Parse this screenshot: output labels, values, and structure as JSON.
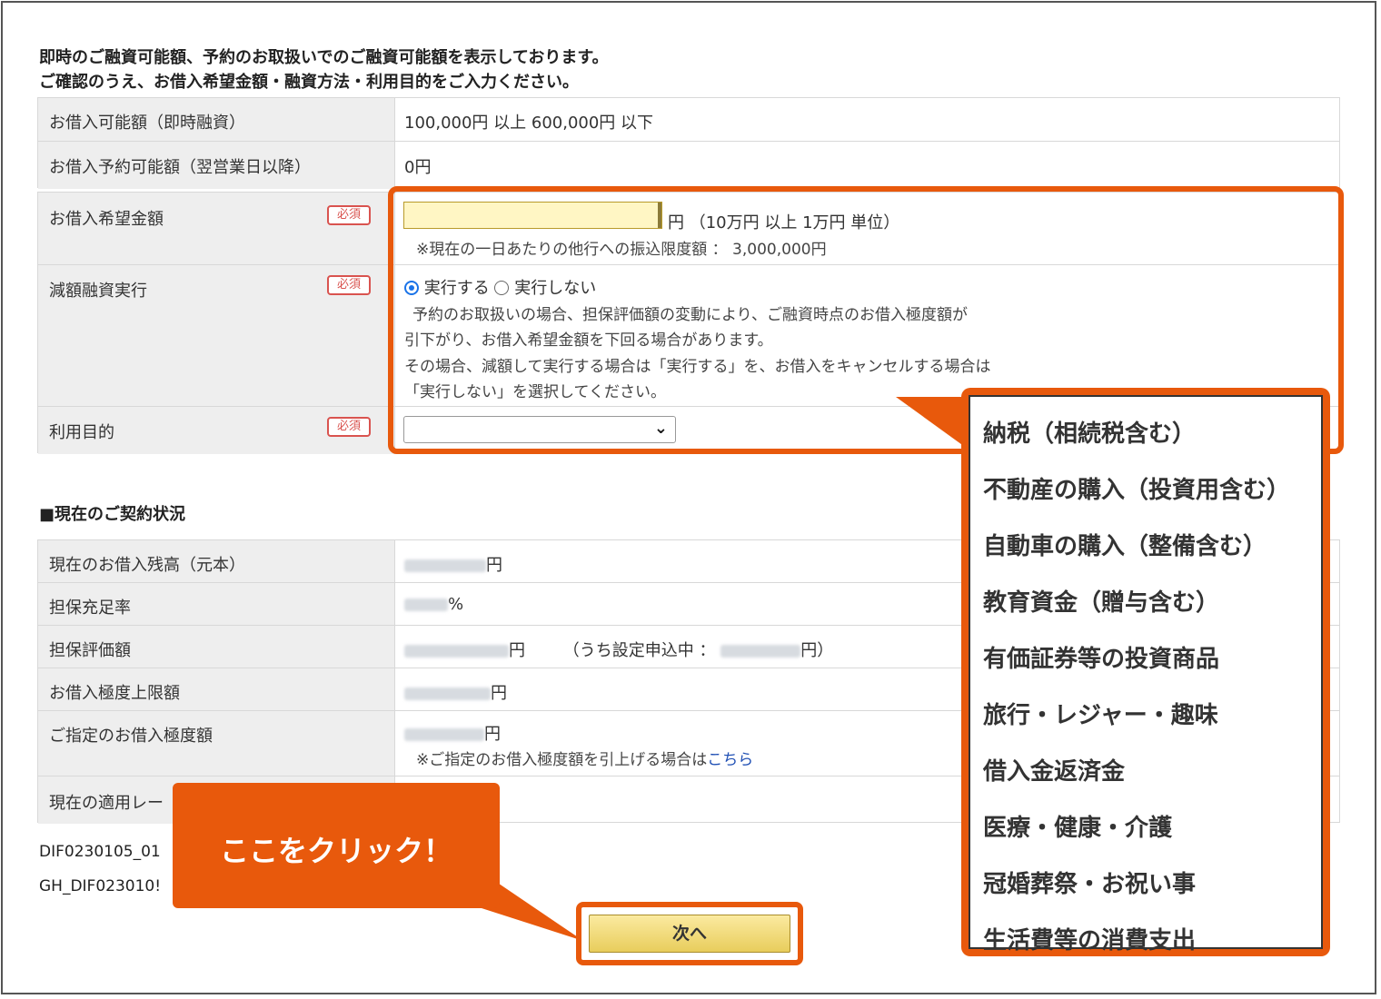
{
  "intro": {
    "line1": "即時のご融資可能額、予約のお取扱いでのご融資可能額を表示しております。",
    "line2": "ご確認のうえ、お借入希望金額・融資方法・利用目的をご入力ください。"
  },
  "availability": [
    {
      "label": "お借入可能額（即時融資）",
      "value": "100,000円 以上 600,000円 以下"
    },
    {
      "label": "お借入予約可能額（翌営業日以降）",
      "value": "0円"
    }
  ],
  "form": {
    "required_badge": "必須",
    "amount": {
      "label": "お借入希望金額",
      "value": "",
      "unit": "円 （10万円 以上 1万円 単位）",
      "note": "※現在の一日あたりの他行への振込限度額 ： 3,000,000円"
    },
    "reduced": {
      "label": "減額融資実行",
      "options": [
        "実行する",
        "実行しない"
      ],
      "selected": "実行する",
      "desc1": "予約のお取扱いの場合、担保評価額の変動により、ご融資時点のお借入極度額が",
      "desc2": "引下がり、お借入希望金額を下回る場合があります。",
      "desc3": "その場合、減額して実行する場合は「実行する」を、お借入をキャンセルする場合は",
      "desc4": "「実行しない」を選択してください。"
    },
    "purpose": {
      "label": "利用目的",
      "selected": "",
      "options": [
        "納税（相続税含む）",
        "不動産の購入（投資用含む）",
        "自動車の購入（整備含む）",
        "教育資金（贈与含む）",
        "有価証券等の投資商品",
        "旅行・レジャー・趣味",
        "借入金返済金",
        "医療・健康・介護",
        "冠婚葬祭・お祝い事",
        "生活費等の消費支出"
      ]
    }
  },
  "contract": {
    "title": "■現在のご契約状況",
    "rows": [
      {
        "label": "現在のお借入残高（元本）",
        "suffix": "円"
      },
      {
        "label": "担保充足率",
        "suffix": "%"
      },
      {
        "label": "担保評価額",
        "suffix": "円",
        "extra_prefix": "（うち設定申込中 ：",
        "extra_suffix": "円）"
      },
      {
        "label": "お借入極度上限額",
        "suffix": "円"
      },
      {
        "label": "ご指定のお借入極度額",
        "suffix": "円",
        "note": "※ご指定のお借入極度額を引上げる場合は",
        "link": "こちら"
      },
      {
        "label": "現在の適用レー"
      }
    ]
  },
  "codes": [
    "DIF0230105_01",
    "GH_DIF023010!"
  ],
  "callout": "ここをクリック！",
  "next_button": "次へ",
  "colors": {
    "accent": "#e8590c",
    "required": "#d9534f",
    "input_bg": "#fff6c4",
    "link": "#1f4fb4"
  }
}
